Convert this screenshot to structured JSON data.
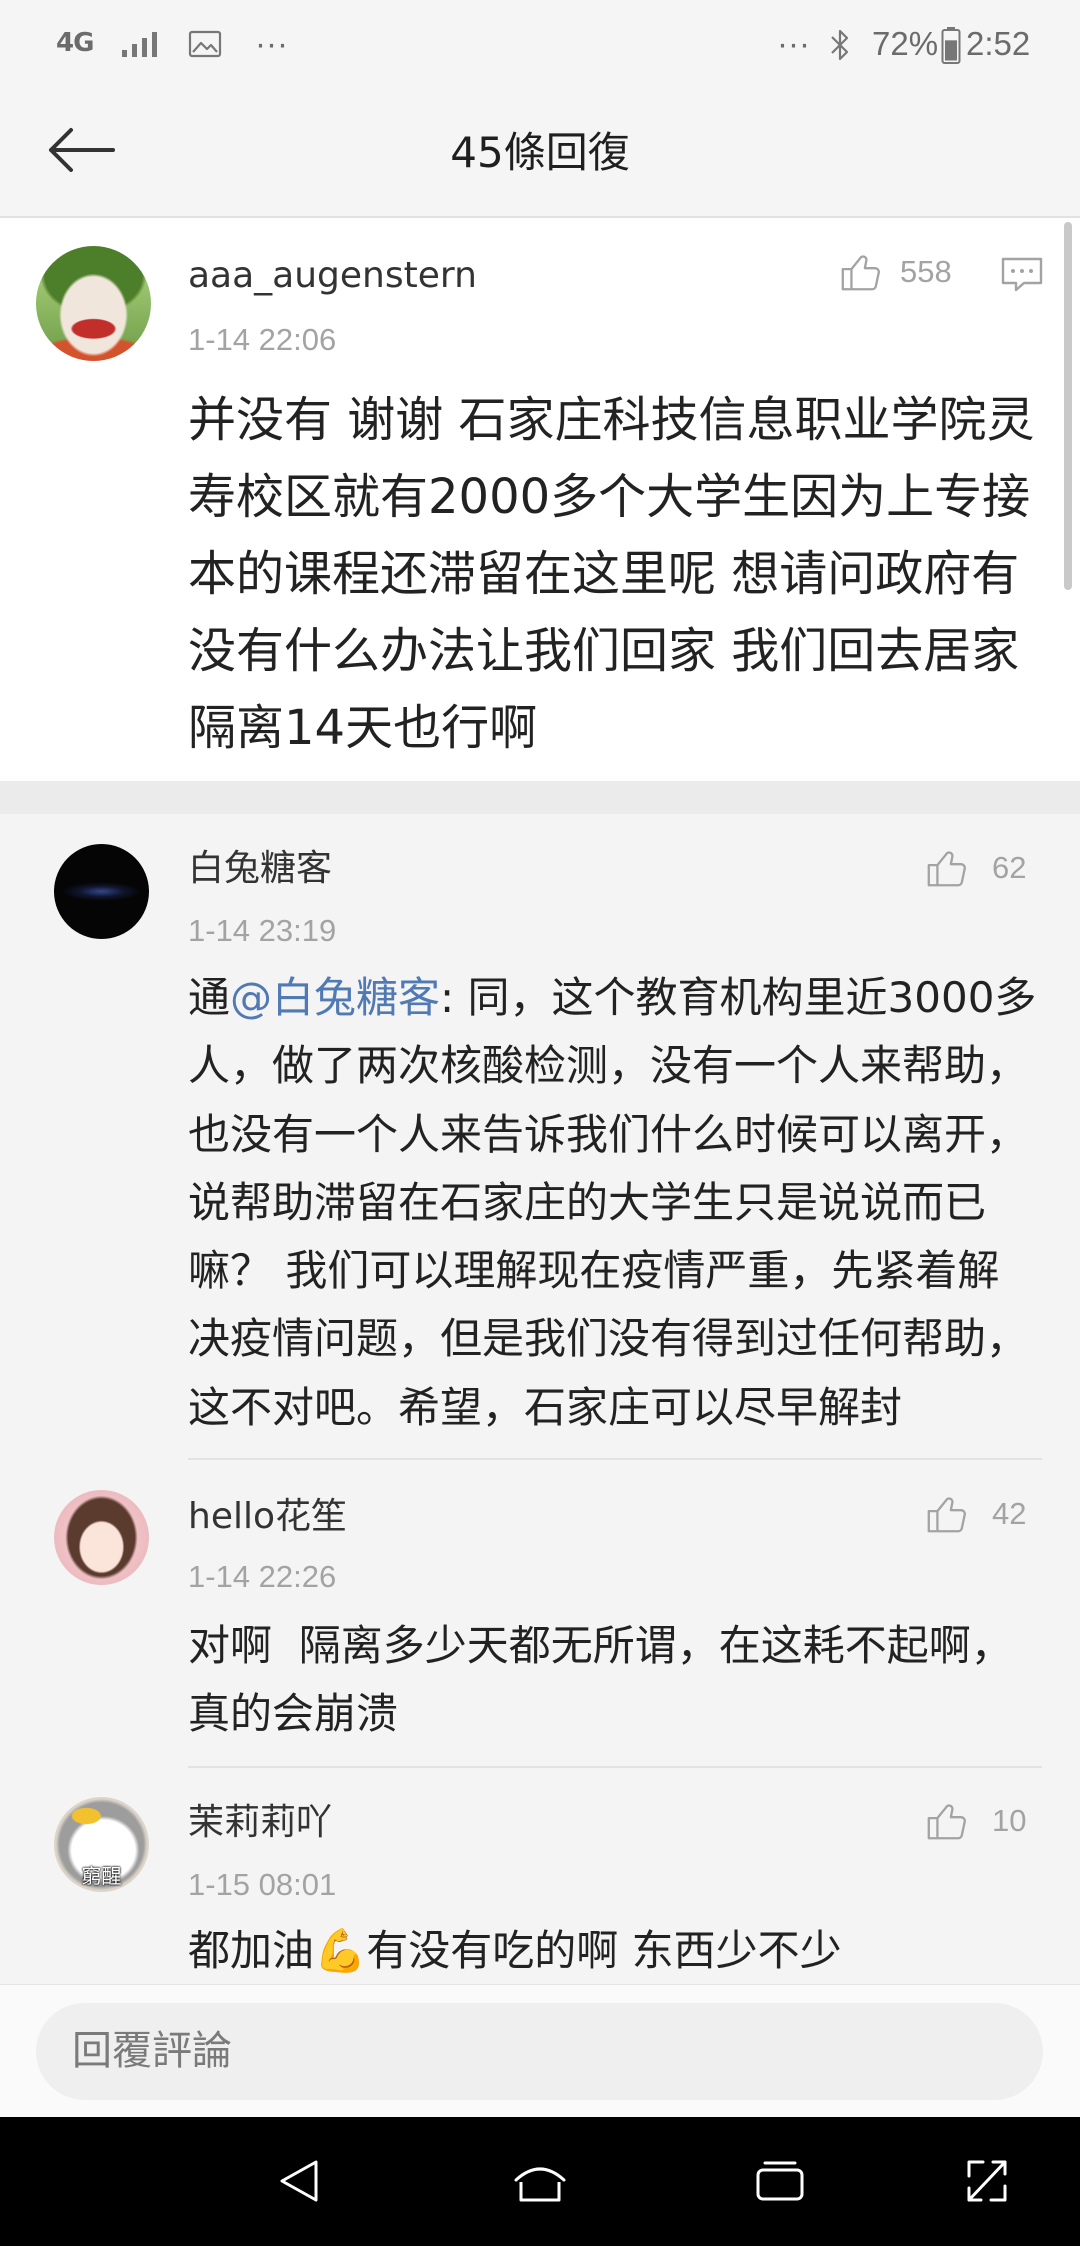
{
  "status_bar": {
    "network_type": "4G",
    "left_more": "···",
    "right_more": "···",
    "battery_percent": "72%",
    "battery_level": 0.72,
    "time": "2:52"
  },
  "header": {
    "title": "45條回復"
  },
  "main_comment": {
    "username": "aaa_augenstern",
    "time": "1-14 22:06",
    "likes": "558",
    "body_lines": [
      "并没有 谢谢 石家庄科技信息职业学院灵",
      "寿校区就有2000多个大学生因为上专接",
      "本的课程还滞留在这里呢 想请问政府有",
      "没有什么办法让我们回家 我们回去居家",
      "隔离14天也行啊"
    ]
  },
  "replies": [
    {
      "username": "白兔糖客",
      "time": "1-14 23:19",
      "likes": "62",
      "lead": {
        "prefix": "通",
        "mention": "@白兔糖客",
        "rest": ": 同，这个教育机构里近3000多"
      },
      "body_lines": [
        "人，做了两次核酸检测，没有一个人来帮助，",
        "也没有一个人来告诉我们什么时候可以离开，",
        "说帮助滞留在石家庄的大学生只是说说而已",
        "嘛？ 我们可以理解现在疫情严重，先紧着解",
        "决疫情问题，但是我们没有得到过任何帮助，",
        "这不对吧。希望，石家庄可以尽早解封"
      ]
    },
    {
      "username": "hello花笙",
      "time": "1-14 22:26",
      "likes": "42",
      "body_lines": [
        "对啊  隔离多少天都无所谓，在这耗不起啊，",
        "真的会崩溃"
      ]
    },
    {
      "username": "茉莉莉吖",
      "time": "1-15 08:01",
      "likes": "10",
      "avatar_caption": "窮醒",
      "body_lines": [
        "都加油💪有没有吃的啊 东西少不少"
      ]
    }
  ],
  "reply_bar": {
    "placeholder": "回覆評論"
  },
  "colors": {
    "mention": "#4f7ab3",
    "body_text": "#222222",
    "meta_text": "#a3a3a3",
    "page_bg": "#f4f4f4",
    "comment_bg": "#ffffff",
    "nav_bar": "#000000"
  },
  "icons": {
    "header_back": "back-arrow-icon",
    "like": "thumbs-up-icon",
    "comment": "comment-bubble-icon",
    "nav_back": "nav-back-icon",
    "nav_home": "nav-home-icon",
    "nav_recent": "nav-recent-apps-icon",
    "nav_expand": "nav-expand-icon"
  }
}
